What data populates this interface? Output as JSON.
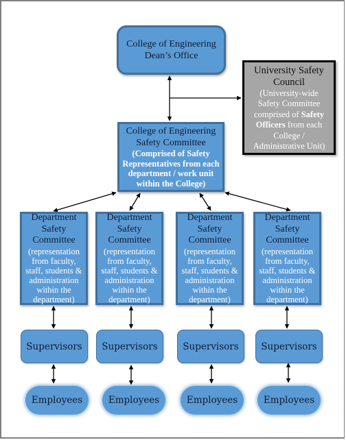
{
  "diagram": {
    "dean_office": {
      "title_line1": "College of Engineering",
      "title_line2": "Dean’s Office"
    },
    "university_council": {
      "title_line1": "University Safety",
      "title_line2": "Council",
      "desc_line1": "(University-wide",
      "desc_line2": "Safety Committee",
      "desc_line3a": "comprised of ",
      "desc_line3b": "Safety",
      "desc_line4a": "Officers",
      "desc_line4b": " from each",
      "desc_line5": "College /",
      "desc_line6": "Administrative Unit)"
    },
    "college_committee": {
      "title_line1": "College of Engineering",
      "title_line2": "Safety Committee",
      "desc_line1a": "(Comprised of ",
      "desc_line1b": "Safety",
      "desc_line2a": "Representatives",
      "desc_line2b": " from each",
      "desc_line3": "department / work unit",
      "desc_line4": "within the College)"
    },
    "department_committees": [
      {
        "title_line1": "Department",
        "title_line2": "Safety",
        "title_line3": "Committee",
        "desc_line1": "(representation",
        "desc_line2": "from faculty,",
        "desc_line3": "staff, students &",
        "desc_line4": "administration",
        "desc_line5": "within the",
        "desc_line6": "department)"
      },
      {
        "title_line1": "Department",
        "title_line2": "Safety",
        "title_line3": "Committee",
        "desc_line1": "(representation",
        "desc_line2": "from faculty,",
        "desc_line3": "staff, students &",
        "desc_line4": "administration",
        "desc_line5": "within the",
        "desc_line6": "department)"
      },
      {
        "title_line1": "Department",
        "title_line2": "Safety",
        "title_line3": "Committee",
        "desc_line1": "(representation",
        "desc_line2": "from faculty,",
        "desc_line3": "staff, students &",
        "desc_line4": "administration",
        "desc_line5": "within the",
        "desc_line6": "department)"
      },
      {
        "title_line1": "Department",
        "title_line2": "Safety",
        "title_line3": "Committee",
        "desc_line1": "(representation",
        "desc_line2": "from faculty,",
        "desc_line3": "staff, students &",
        "desc_line4": "administration",
        "desc_line5": "within the",
        "desc_line6": "department)"
      }
    ],
    "supervisors": [
      "Supervisors",
      "Supervisors",
      "Supervisors",
      "Supervisors"
    ],
    "employees": [
      "Employees",
      "Employees",
      "Employees",
      "Employees"
    ],
    "colors": {
      "node_fill": "#5b9bd5",
      "node_border": "#41709c",
      "council_fill": "#a6a6a6",
      "council_border": "#000000",
      "title_text": "#111a33",
      "desc_text": "#ffffff",
      "connector": "#000000"
    },
    "connections": [
      {
        "from": "dean_office",
        "to": "college_committee",
        "type": "bidirectional"
      },
      {
        "from": "dean_college_link",
        "to": "university_council",
        "type": "arrow"
      },
      {
        "from": "college_committee",
        "to": "department_committees.0",
        "type": "bidirectional"
      },
      {
        "from": "college_committee",
        "to": "department_committees.1",
        "type": "bidirectional"
      },
      {
        "from": "college_committee",
        "to": "department_committees.2",
        "type": "bidirectional"
      },
      {
        "from": "college_committee",
        "to": "department_committees.3",
        "type": "bidirectional"
      },
      {
        "from": "department_committees.0",
        "to": "supervisors.0",
        "type": "bidirectional"
      },
      {
        "from": "department_committees.1",
        "to": "supervisors.1",
        "type": "bidirectional"
      },
      {
        "from": "department_committees.2",
        "to": "supervisors.2",
        "type": "bidirectional"
      },
      {
        "from": "department_committees.3",
        "to": "supervisors.3",
        "type": "bidirectional"
      },
      {
        "from": "supervisors.0",
        "to": "employees.0",
        "type": "bidirectional"
      },
      {
        "from": "supervisors.1",
        "to": "employees.1",
        "type": "bidirectional"
      },
      {
        "from": "supervisors.2",
        "to": "employees.2",
        "type": "bidirectional"
      },
      {
        "from": "supervisors.3",
        "to": "employees.3",
        "type": "bidirectional"
      }
    ]
  }
}
